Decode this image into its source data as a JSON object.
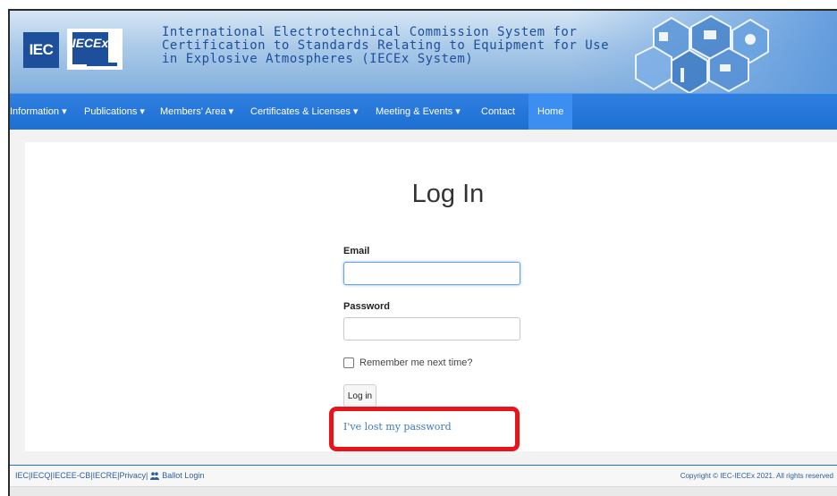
{
  "header": {
    "logo_iec": "IEC",
    "logo_iecex": "IECEx",
    "title_lines": [
      "International Electrotechnical Commission System for",
      "Certification to Standards Relating to Equipment for Use",
      "in Explosive Atmospheres (IECEx System)"
    ]
  },
  "nav": {
    "items": [
      {
        "label": "Information ▾"
      },
      {
        "label": "Publications ▾"
      },
      {
        "label": "Members' Area ▾"
      },
      {
        "label": "Certificates & Licenses ▾"
      },
      {
        "label": "Meeting & Events ▾"
      },
      {
        "label": "Contact"
      },
      {
        "label": "Home"
      }
    ]
  },
  "login": {
    "title": "Log In",
    "email_label": "Email",
    "email_value": "",
    "password_label": "Password",
    "password_value": "",
    "remember_label": "Remember me next time?",
    "login_button": "Log in",
    "lost_password": "I've lost my password"
  },
  "footer": {
    "links": [
      "IEC",
      "IECQ",
      "IECEE-CB",
      "IECRE",
      "Privacy"
    ],
    "ballot_login": "Ballot Login",
    "separator": " | ",
    "copyright": "Copyright © IEC-IECEx 2021. All rights reserved"
  },
  "colors": {
    "accent": "#1e6fd3",
    "brand": "#1d4f9b",
    "highlight": "#e8141c"
  },
  "icons": {
    "people": "people-icon"
  }
}
